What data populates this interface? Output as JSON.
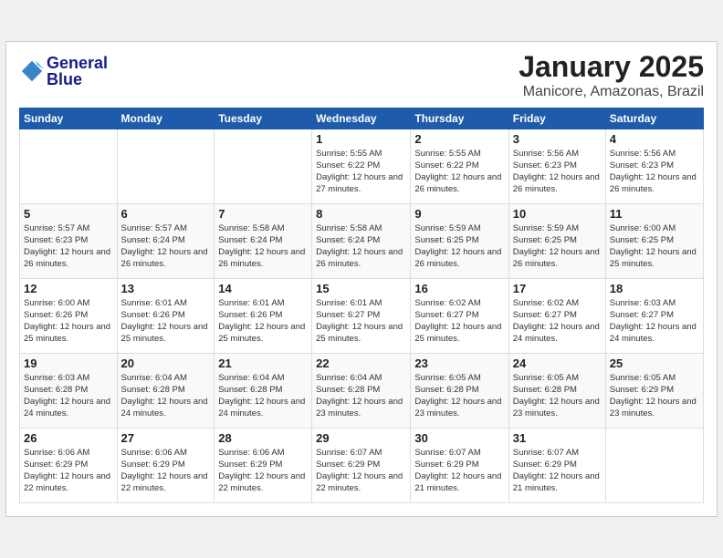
{
  "header": {
    "logo_line1": "General",
    "logo_line2": "Blue",
    "month_year": "January 2025",
    "location": "Manicore, Amazonas, Brazil"
  },
  "weekdays": [
    "Sunday",
    "Monday",
    "Tuesday",
    "Wednesday",
    "Thursday",
    "Friday",
    "Saturday"
  ],
  "weeks": [
    [
      {
        "day": "",
        "sunrise": "",
        "sunset": "",
        "daylight": "",
        "empty": true
      },
      {
        "day": "",
        "sunrise": "",
        "sunset": "",
        "daylight": "",
        "empty": true
      },
      {
        "day": "",
        "sunrise": "",
        "sunset": "",
        "daylight": "",
        "empty": true
      },
      {
        "day": "1",
        "sunrise": "Sunrise: 5:55 AM",
        "sunset": "Sunset: 6:22 PM",
        "daylight": "Daylight: 12 hours and 27 minutes.",
        "empty": false
      },
      {
        "day": "2",
        "sunrise": "Sunrise: 5:55 AM",
        "sunset": "Sunset: 6:22 PM",
        "daylight": "Daylight: 12 hours and 26 minutes.",
        "empty": false
      },
      {
        "day": "3",
        "sunrise": "Sunrise: 5:56 AM",
        "sunset": "Sunset: 6:23 PM",
        "daylight": "Daylight: 12 hours and 26 minutes.",
        "empty": false
      },
      {
        "day": "4",
        "sunrise": "Sunrise: 5:56 AM",
        "sunset": "Sunset: 6:23 PM",
        "daylight": "Daylight: 12 hours and 26 minutes.",
        "empty": false
      }
    ],
    [
      {
        "day": "5",
        "sunrise": "Sunrise: 5:57 AM",
        "sunset": "Sunset: 6:23 PM",
        "daylight": "Daylight: 12 hours and 26 minutes.",
        "empty": false
      },
      {
        "day": "6",
        "sunrise": "Sunrise: 5:57 AM",
        "sunset": "Sunset: 6:24 PM",
        "daylight": "Daylight: 12 hours and 26 minutes.",
        "empty": false
      },
      {
        "day": "7",
        "sunrise": "Sunrise: 5:58 AM",
        "sunset": "Sunset: 6:24 PM",
        "daylight": "Daylight: 12 hours and 26 minutes.",
        "empty": false
      },
      {
        "day": "8",
        "sunrise": "Sunrise: 5:58 AM",
        "sunset": "Sunset: 6:24 PM",
        "daylight": "Daylight: 12 hours and 26 minutes.",
        "empty": false
      },
      {
        "day": "9",
        "sunrise": "Sunrise: 5:59 AM",
        "sunset": "Sunset: 6:25 PM",
        "daylight": "Daylight: 12 hours and 26 minutes.",
        "empty": false
      },
      {
        "day": "10",
        "sunrise": "Sunrise: 5:59 AM",
        "sunset": "Sunset: 6:25 PM",
        "daylight": "Daylight: 12 hours and 26 minutes.",
        "empty": false
      },
      {
        "day": "11",
        "sunrise": "Sunrise: 6:00 AM",
        "sunset": "Sunset: 6:25 PM",
        "daylight": "Daylight: 12 hours and 25 minutes.",
        "empty": false
      }
    ],
    [
      {
        "day": "12",
        "sunrise": "Sunrise: 6:00 AM",
        "sunset": "Sunset: 6:26 PM",
        "daylight": "Daylight: 12 hours and 25 minutes.",
        "empty": false
      },
      {
        "day": "13",
        "sunrise": "Sunrise: 6:01 AM",
        "sunset": "Sunset: 6:26 PM",
        "daylight": "Daylight: 12 hours and 25 minutes.",
        "empty": false
      },
      {
        "day": "14",
        "sunrise": "Sunrise: 6:01 AM",
        "sunset": "Sunset: 6:26 PM",
        "daylight": "Daylight: 12 hours and 25 minutes.",
        "empty": false
      },
      {
        "day": "15",
        "sunrise": "Sunrise: 6:01 AM",
        "sunset": "Sunset: 6:27 PM",
        "daylight": "Daylight: 12 hours and 25 minutes.",
        "empty": false
      },
      {
        "day": "16",
        "sunrise": "Sunrise: 6:02 AM",
        "sunset": "Sunset: 6:27 PM",
        "daylight": "Daylight: 12 hours and 25 minutes.",
        "empty": false
      },
      {
        "day": "17",
        "sunrise": "Sunrise: 6:02 AM",
        "sunset": "Sunset: 6:27 PM",
        "daylight": "Daylight: 12 hours and 24 minutes.",
        "empty": false
      },
      {
        "day": "18",
        "sunrise": "Sunrise: 6:03 AM",
        "sunset": "Sunset: 6:27 PM",
        "daylight": "Daylight: 12 hours and 24 minutes.",
        "empty": false
      }
    ],
    [
      {
        "day": "19",
        "sunrise": "Sunrise: 6:03 AM",
        "sunset": "Sunset: 6:28 PM",
        "daylight": "Daylight: 12 hours and 24 minutes.",
        "empty": false
      },
      {
        "day": "20",
        "sunrise": "Sunrise: 6:04 AM",
        "sunset": "Sunset: 6:28 PM",
        "daylight": "Daylight: 12 hours and 24 minutes.",
        "empty": false
      },
      {
        "day": "21",
        "sunrise": "Sunrise: 6:04 AM",
        "sunset": "Sunset: 6:28 PM",
        "daylight": "Daylight: 12 hours and 24 minutes.",
        "empty": false
      },
      {
        "day": "22",
        "sunrise": "Sunrise: 6:04 AM",
        "sunset": "Sunset: 6:28 PM",
        "daylight": "Daylight: 12 hours and 23 minutes.",
        "empty": false
      },
      {
        "day": "23",
        "sunrise": "Sunrise: 6:05 AM",
        "sunset": "Sunset: 6:28 PM",
        "daylight": "Daylight: 12 hours and 23 minutes.",
        "empty": false
      },
      {
        "day": "24",
        "sunrise": "Sunrise: 6:05 AM",
        "sunset": "Sunset: 6:28 PM",
        "daylight": "Daylight: 12 hours and 23 minutes.",
        "empty": false
      },
      {
        "day": "25",
        "sunrise": "Sunrise: 6:05 AM",
        "sunset": "Sunset: 6:29 PM",
        "daylight": "Daylight: 12 hours and 23 minutes.",
        "empty": false
      }
    ],
    [
      {
        "day": "26",
        "sunrise": "Sunrise: 6:06 AM",
        "sunset": "Sunset: 6:29 PM",
        "daylight": "Daylight: 12 hours and 22 minutes.",
        "empty": false
      },
      {
        "day": "27",
        "sunrise": "Sunrise: 6:06 AM",
        "sunset": "Sunset: 6:29 PM",
        "daylight": "Daylight: 12 hours and 22 minutes.",
        "empty": false
      },
      {
        "day": "28",
        "sunrise": "Sunrise: 6:06 AM",
        "sunset": "Sunset: 6:29 PM",
        "daylight": "Daylight: 12 hours and 22 minutes.",
        "empty": false
      },
      {
        "day": "29",
        "sunrise": "Sunrise: 6:07 AM",
        "sunset": "Sunset: 6:29 PM",
        "daylight": "Daylight: 12 hours and 22 minutes.",
        "empty": false
      },
      {
        "day": "30",
        "sunrise": "Sunrise: 6:07 AM",
        "sunset": "Sunset: 6:29 PM",
        "daylight": "Daylight: 12 hours and 21 minutes.",
        "empty": false
      },
      {
        "day": "31",
        "sunrise": "Sunrise: 6:07 AM",
        "sunset": "Sunset: 6:29 PM",
        "daylight": "Daylight: 12 hours and 21 minutes.",
        "empty": false
      },
      {
        "day": "",
        "sunrise": "",
        "sunset": "",
        "daylight": "",
        "empty": true
      }
    ]
  ]
}
